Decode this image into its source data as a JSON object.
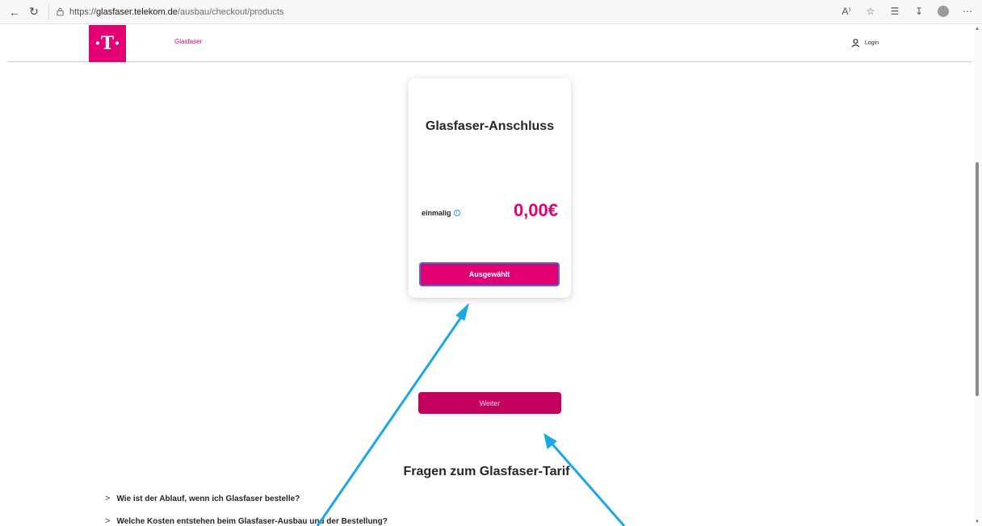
{
  "browser": {
    "url_scheme": "https://",
    "url_host": "glasfaser.telekom.de",
    "url_path": "/ausbau/checkout/products",
    "read_aloud_icon": "A⁾"
  },
  "header": {
    "logo_letter": "·T·",
    "nav_link": "Glasfaser",
    "login_label": "Login"
  },
  "product_card": {
    "title": "Glasfaser-Anschluss",
    "price_label": "einmalig",
    "info_icon": "i",
    "price": "0,00€",
    "button_label": "Ausgewählt"
  },
  "continue_button": "Weiter",
  "faq": {
    "title": "Fragen zum Glasfaser-Tarif",
    "items": [
      "Wie ist der Ablauf, wenn ich Glasfaser bestelle?",
      "Welche Kosten entstehen beim Glasfaser-Ausbau und der Bestellung?"
    ]
  },
  "colors": {
    "brand": "#e20074",
    "continue_button": "#c4005e",
    "annotation_arrow": "#1aa7e6"
  }
}
